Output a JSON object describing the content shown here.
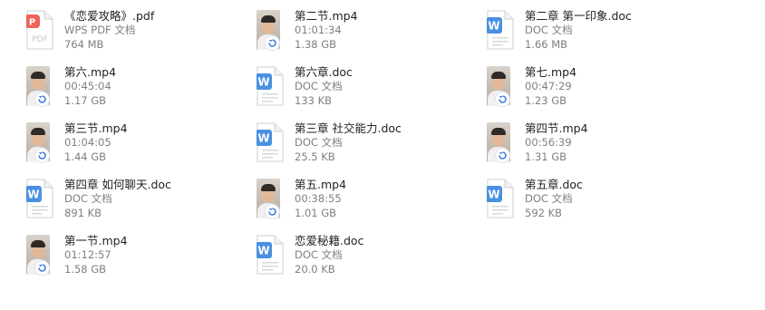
{
  "files": [
    {
      "name": "《恋爱攻略》.pdf",
      "detail": "WPS PDF 文档",
      "size": "764 MB",
      "type": "pdf"
    },
    {
      "name": "第二节.mp4",
      "detail": "01:01:34",
      "size": "1.38 GB",
      "type": "video"
    },
    {
      "name": "第二章 第一印象.doc",
      "detail": "DOC 文档",
      "size": "1.66 MB",
      "type": "doc"
    },
    {
      "name": "第六.mp4",
      "detail": "00:45:04",
      "size": "1.17 GB",
      "type": "video"
    },
    {
      "name": "第六章.doc",
      "detail": "DOC 文档",
      "size": "133 KB",
      "type": "doc"
    },
    {
      "name": "第七.mp4",
      "detail": "00:47:29",
      "size": "1.23 GB",
      "type": "video"
    },
    {
      "name": "第三节.mp4",
      "detail": "01:04:05",
      "size": "1.44 GB",
      "type": "video"
    },
    {
      "name": "第三章 社交能力.doc",
      "detail": "DOC 文档",
      "size": "25.5 KB",
      "type": "doc"
    },
    {
      "name": "第四节.mp4",
      "detail": "00:56:39",
      "size": "1.31 GB",
      "type": "video"
    },
    {
      "name": "第四章 如何聊天.doc",
      "detail": "DOC 文档",
      "size": "891 KB",
      "type": "doc"
    },
    {
      "name": "第五.mp4",
      "detail": "00:38:55",
      "size": "1.01 GB",
      "type": "video"
    },
    {
      "name": "第五章.doc",
      "detail": "DOC 文档",
      "size": "592 KB",
      "type": "doc"
    },
    {
      "name": "第一节.mp4",
      "detail": "01:12:57",
      "size": "1.58 GB",
      "type": "video"
    },
    {
      "name": "恋爱秘籍.doc",
      "detail": "DOC 文档",
      "size": "20.0 KB",
      "type": "doc"
    }
  ],
  "icons": {
    "pdf": "pdf-file-icon",
    "doc": "doc-file-icon",
    "video": "video-thumbnail-icon"
  },
  "colors": {
    "pdf_accent": "#f0625a",
    "doc_accent": "#4a90e2",
    "badge": "#3d7fe0"
  }
}
